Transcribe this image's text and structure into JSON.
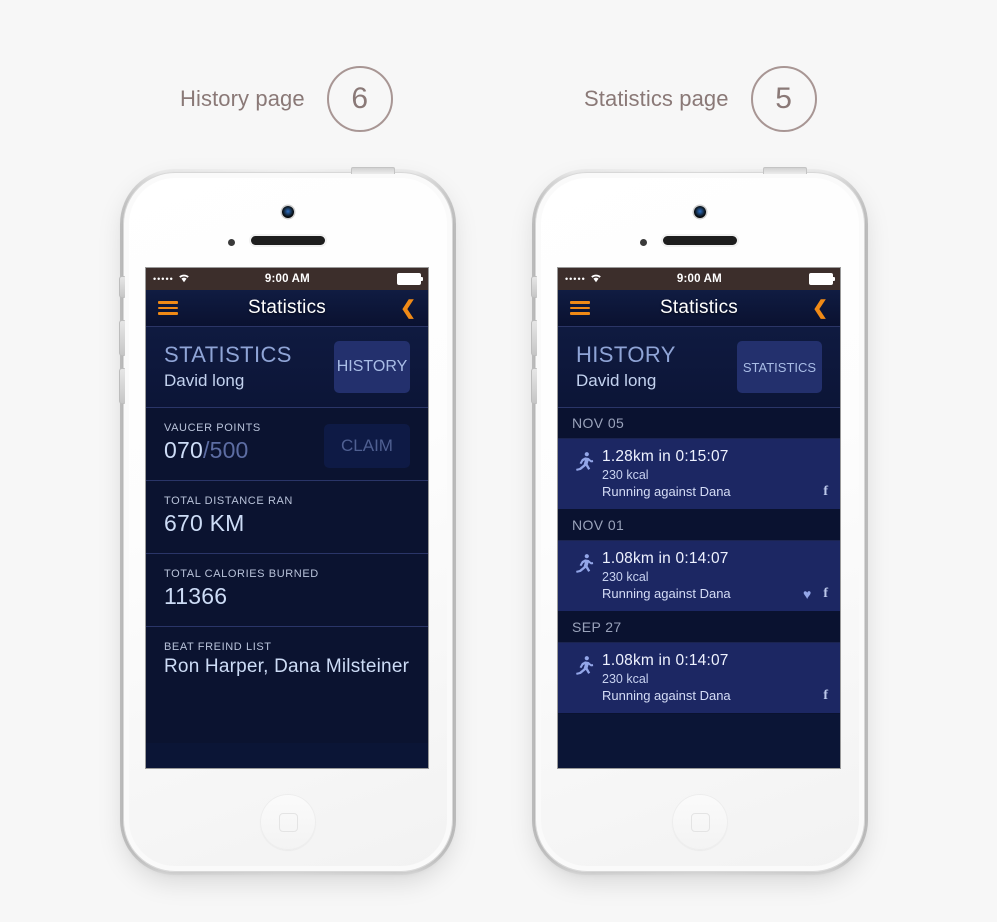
{
  "captions": [
    {
      "text": "History page",
      "number": "6"
    },
    {
      "text": "Statistics page",
      "number": "5"
    }
  ],
  "status_bar": {
    "dots": "•••••",
    "wifi": "wifi-icon",
    "time": "9:00 AM"
  },
  "nav": {
    "title": "Statistics",
    "menu_icon": "hamburger-menu-icon",
    "back_icon": "❮"
  },
  "phone1": {
    "profile": {
      "title": "STATISTICS",
      "name": "David long",
      "toggle_label": "HISTORY"
    },
    "rows": [
      {
        "label": "VAUCER POINTS",
        "value": "070",
        "value_dim": "/500",
        "action": "CLAIM"
      },
      {
        "label": "TOTAL DISTANCE RAN",
        "value": "670 KM"
      },
      {
        "label": "TOTAL CALORIES BURNED",
        "value": "11366"
      },
      {
        "label": "BEAT FREIND LIST",
        "value": "Ron Harper, Dana Milsteiner"
      }
    ]
  },
  "phone2": {
    "profile": {
      "title": "HISTORY",
      "name": "David long",
      "toggle_label": "STATISTICS"
    },
    "groups": [
      {
        "date": "NOV 05",
        "run": {
          "distance": "1.28km in 0:15:07",
          "kcal": "230 kcal",
          "against": "Running against Dana",
          "heart": false,
          "facebook": "f"
        }
      },
      {
        "date": "NOV 01",
        "run": {
          "distance": "1.08km in 0:14:07",
          "kcal": "230 kcal",
          "against": "Running against Dana",
          "heart": true,
          "facebook": "f"
        }
      },
      {
        "date": "SEP 27",
        "run": {
          "distance": "1.08km in 0:14:07",
          "kcal": "230 kcal",
          "against": "Running against Dana",
          "heart": false,
          "facebook": "f"
        }
      }
    ]
  },
  "colors": {
    "accent_orange": "#f08a16",
    "screen_navy": "#0b1536",
    "row_blue": "#1c2763",
    "status_brown": "#3c2e2b",
    "caption_mauve": "#8a7977"
  },
  "icons": {
    "runner": "🏃",
    "heart": "♥",
    "back_chevron": "❮"
  }
}
